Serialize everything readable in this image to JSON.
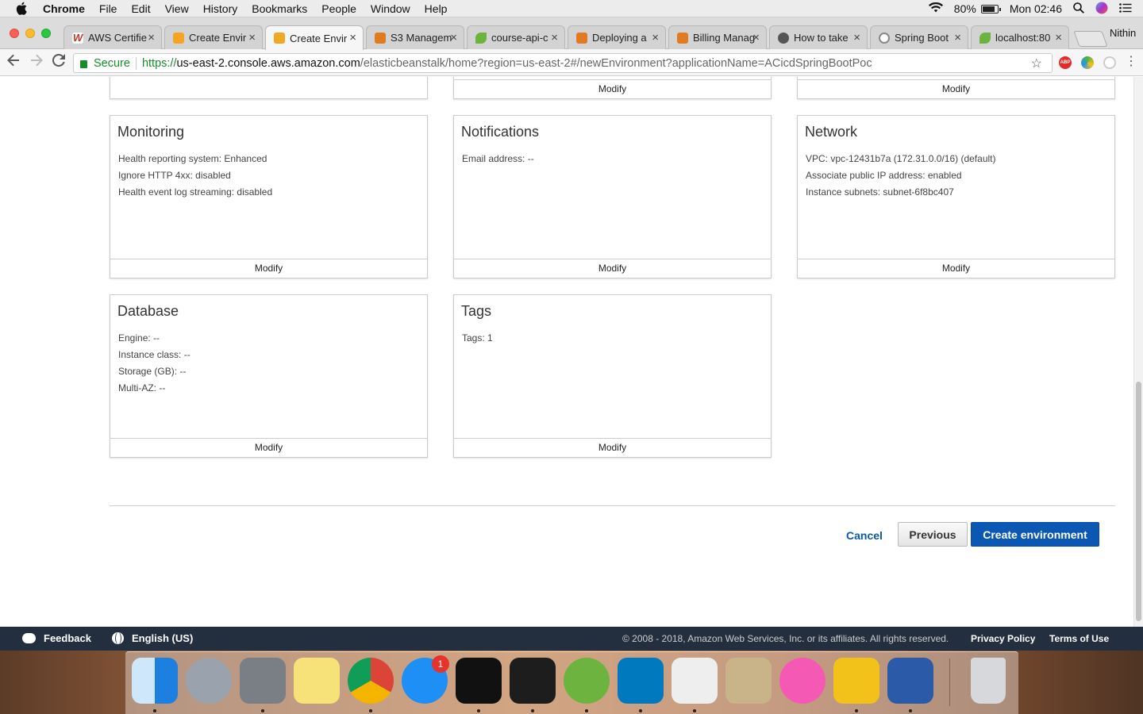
{
  "menubar": {
    "app": "Chrome",
    "items": [
      "File",
      "Edit",
      "View",
      "History",
      "Bookmarks",
      "People",
      "Window",
      "Help"
    ],
    "battery": "80%",
    "clock": "Mon 02:46"
  },
  "tabs": [
    {
      "title": "AWS Certifie",
      "fav": "#c0392b"
    },
    {
      "title": "Create Envir",
      "fav": "#f2a623"
    },
    {
      "title": "Create Envir",
      "fav": "#f2a623",
      "active": true
    },
    {
      "title": "S3 Managem",
      "fav": "#e07b24"
    },
    {
      "title": "course-api-c",
      "fav": "#6db33f"
    },
    {
      "title": "Deploying a",
      "fav": "#e07b24"
    },
    {
      "title": "Billing Manag",
      "fav": "#e07b24"
    },
    {
      "title": "How to take",
      "fav": "#555555"
    },
    {
      "title": "Spring Boot",
      "fav": "#888888"
    },
    {
      "title": "localhost:80",
      "fav": "#6db33f"
    }
  ],
  "profile": "Nithin",
  "address": {
    "secure": "Secure",
    "scheme": "https://",
    "host": "us-east-2.console.aws.amazon.com",
    "path": "/elasticbeanstalk/home?region=us-east-2#/newEnvironment?applicationName=ACicdSpringBootPoc"
  },
  "modify_label": "Modify",
  "cards": {
    "monitoring": {
      "title": "Monitoring",
      "lines": [
        "Health reporting system: Enhanced",
        "Ignore HTTP 4xx: disabled",
        "Health event log streaming: disabled"
      ]
    },
    "notifications": {
      "title": "Notifications",
      "lines": [
        "Email address: --"
      ]
    },
    "network": {
      "title": "Network",
      "lines": [
        "VPC: vpc-12431b7a (172.31.0.0/16) (default)",
        "Associate public IP address: enabled",
        "Instance subnets: subnet-6f8bc407"
      ]
    },
    "database": {
      "title": "Database",
      "lines": [
        "Engine: --",
        "Instance class: --",
        "Storage (GB): --",
        "Multi-AZ: --"
      ]
    },
    "tags": {
      "title": "Tags",
      "lines": [
        "Tags: 1"
      ]
    }
  },
  "actions": {
    "cancel": "Cancel",
    "previous": "Previous",
    "create": "Create environment"
  },
  "footer": {
    "feedback": "Feedback",
    "language": "English (US)",
    "copyright": "© 2008 - 2018, Amazon Web Services, Inc. or its affiliates. All rights reserved.",
    "privacy": "Privacy Policy",
    "terms": "Terms of Use"
  },
  "dock": {
    "apps": [
      {
        "name": "finder-icon",
        "color": "#3a8ee6",
        "running": true
      },
      {
        "name": "launchpad-icon",
        "color": "#9aa3ad",
        "running": false
      },
      {
        "name": "system-preferences-icon",
        "color": "#7a7f86",
        "running": true
      },
      {
        "name": "notes-icon",
        "color": "#f7e27a",
        "running": false
      },
      {
        "name": "chrome-icon",
        "color": "#db4437",
        "running": true
      },
      {
        "name": "app-store-icon",
        "color": "#1e8ff5",
        "running": false
      },
      {
        "name": "intellij-icon",
        "color": "#111111",
        "running": true
      },
      {
        "name": "terminal-icon",
        "color": "#1d1d1d",
        "running": true
      },
      {
        "name": "spring-tool-suite-icon",
        "color": "#6db33f",
        "running": true
      },
      {
        "name": "trello-icon",
        "color": "#0079bf",
        "running": true
      },
      {
        "name": "textedit-icon",
        "color": "#eeeeee",
        "running": true
      },
      {
        "name": "keychain-icon",
        "color": "#c9b48a",
        "running": false
      },
      {
        "name": "itunes-icon",
        "color": "#f45ab4",
        "running": false
      },
      {
        "name": "winzip-icon",
        "color": "#f2c21b",
        "running": true
      },
      {
        "name": "word-icon",
        "color": "#2b5aa8",
        "running": true
      },
      {
        "name": "trash-icon",
        "color": "#d6d8db",
        "running": false
      }
    ],
    "badge": "1"
  }
}
